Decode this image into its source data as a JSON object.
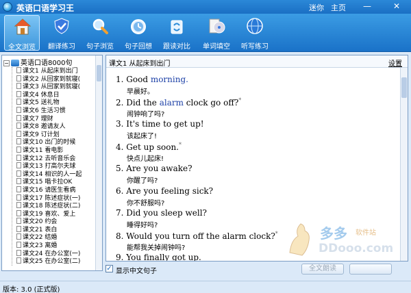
{
  "window": {
    "title": "英语口语学习王",
    "links": [
      "迷你",
      "主页"
    ]
  },
  "toolbar": {
    "items": [
      {
        "label": "全文浏览",
        "icon": "home-icon",
        "active": true
      },
      {
        "label": "翻译练习",
        "icon": "shield-check-icon",
        "active": false
      },
      {
        "label": "句子浏览",
        "icon": "magnifier-icon",
        "active": false
      },
      {
        "label": "句子回想",
        "icon": "alarm-clock-icon",
        "active": false
      },
      {
        "label": "跟读对比",
        "icon": "recycle-icon",
        "active": false
      },
      {
        "label": "单词填空",
        "icon": "cd-icon",
        "active": false
      },
      {
        "label": "听写练习",
        "icon": "globe-icon",
        "active": false
      }
    ]
  },
  "tree": {
    "root": "英语口语8000句",
    "items": [
      "课文1 从起床到出门",
      "课文2 从回家到就寝(",
      "课文3 从回家到就寝(",
      "课文4 休息日",
      "课文5 送礼物",
      "课文6 生活习惯",
      "课文7 理财",
      "课文8 邀请友人",
      "课文9 订计划",
      "课文10 出门的时候",
      "课文11 看电影",
      "课文12 去听音乐会",
      "课文13 打高尔夫球",
      "课文14 相识的人一起",
      "课文15 唱卡拉OK",
      "课文16 请医生看病",
      "课文17 陈述症状(一)",
      "课文18 陈述症状(二)",
      "课文19 喜欢、爱上",
      "课文20 约会",
      "课文21 表白",
      "课文22 结婚",
      "课文23 离婚",
      "课文24 在办公室(一)",
      "课文25 在办公室(二)"
    ]
  },
  "content": {
    "lesson_title": "课文1 从起床到出门",
    "settings_label": "设置",
    "sentences": [
      {
        "num": "1.",
        "en_pre": "Good ",
        "keyword": "morning.",
        "en_post": "",
        "star": false,
        "zh": "早晨好。"
      },
      {
        "num": "2.",
        "en_pre": "Did the ",
        "keyword": "alarm",
        "en_post": " clock go off?",
        "star": true,
        "zh": "闹钟响了吗?"
      },
      {
        "num": "3.",
        "en_pre": "It's time to get up!",
        "keyword": "",
        "en_post": "",
        "star": false,
        "zh": "该起床了!"
      },
      {
        "num": "4.",
        "en_pre": "Get up soon.",
        "keyword": "",
        "en_post": "",
        "star": true,
        "zh": "快点儿起床!"
      },
      {
        "num": "5.",
        "en_pre": "Are you awake?",
        "keyword": "",
        "en_post": "",
        "star": false,
        "zh": "你醒了吗?"
      },
      {
        "num": "6.",
        "en_pre": "Are you feeling sick?",
        "keyword": "",
        "en_post": "",
        "star": false,
        "zh": "你不舒服吗?"
      },
      {
        "num": "7.",
        "en_pre": "Did you sleep well?",
        "keyword": "",
        "en_post": "",
        "star": false,
        "zh": "睡得好吗?"
      },
      {
        "num": "8.",
        "en_pre": "Would you turn off the alarm clock?",
        "keyword": "",
        "en_post": "",
        "star": true,
        "zh": "能帮我关掉闹钟吗?"
      },
      {
        "num": "9.",
        "en_pre": "You finally got up.",
        "keyword": "",
        "en_post": "",
        "star": false,
        "zh": ""
      }
    ],
    "star_glyph": "*"
  },
  "watermark": {
    "brand": "多多",
    "site": "软件站",
    "domain": "DDooo.com"
  },
  "bottom": {
    "checkbox_label": "显示中文句子",
    "checkbox_checked": true,
    "buttons": [
      "全文朗读",
      ""
    ]
  },
  "status": "版本: 3.0  (正式版)",
  "colors": {
    "accent": "#1a72c8",
    "keyword": "#1b3fa6"
  }
}
